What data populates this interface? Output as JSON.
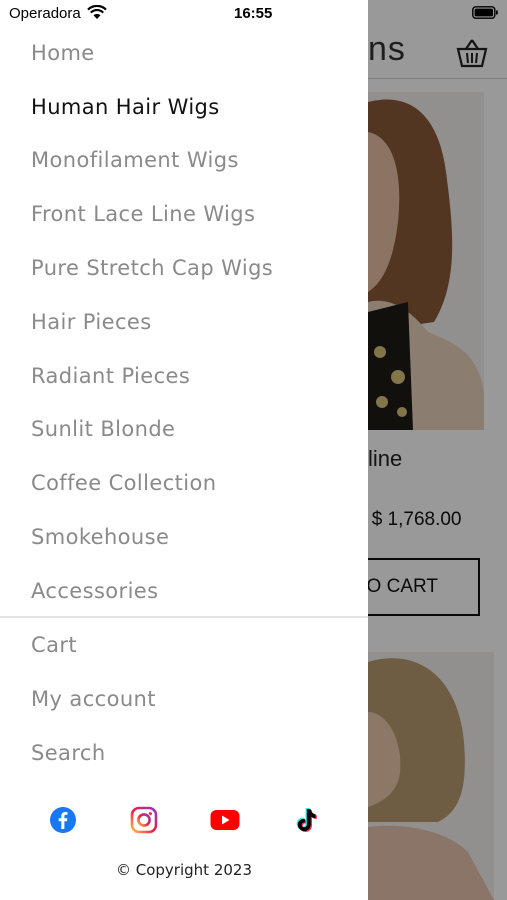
{
  "status_bar": {
    "carrier": "Operadora",
    "time": "16:55"
  },
  "background": {
    "title_fragment": "ns",
    "product_name_fragment": "line",
    "price_old_fragment": "S",
    "price": "$ 1,768.00",
    "cart_button_fragment": "TO CART"
  },
  "menu": {
    "items": [
      {
        "label": "Home",
        "active": false
      },
      {
        "label": "Human Hair Wigs",
        "active": true
      },
      {
        "label": "Monofilament Wigs",
        "active": false
      },
      {
        "label": "Front Lace Line Wigs",
        "active": false
      },
      {
        "label": "Pure Stretch Cap Wigs",
        "active": false
      },
      {
        "label": "Hair Pieces",
        "active": false
      },
      {
        "label": "Radiant Pieces",
        "active": false
      },
      {
        "label": "Sunlit Blonde",
        "active": false
      },
      {
        "label": "Coffee Collection",
        "active": false
      },
      {
        "label": "Smokehouse",
        "active": false
      },
      {
        "label": "Accessories",
        "active": false
      }
    ],
    "secondary": [
      {
        "label": "Cart"
      },
      {
        "label": "My account"
      },
      {
        "label": "Search"
      }
    ]
  },
  "socials": [
    {
      "icon": "facebook-icon",
      "color": "#1877F2"
    },
    {
      "icon": "instagram-icon",
      "color": "#E1306C"
    },
    {
      "icon": "youtube-icon",
      "color": "#FF0000"
    },
    {
      "icon": "tiktok-icon",
      "color": "#000000"
    }
  ],
  "footer": {
    "copyright": "© Copyright 2023"
  }
}
